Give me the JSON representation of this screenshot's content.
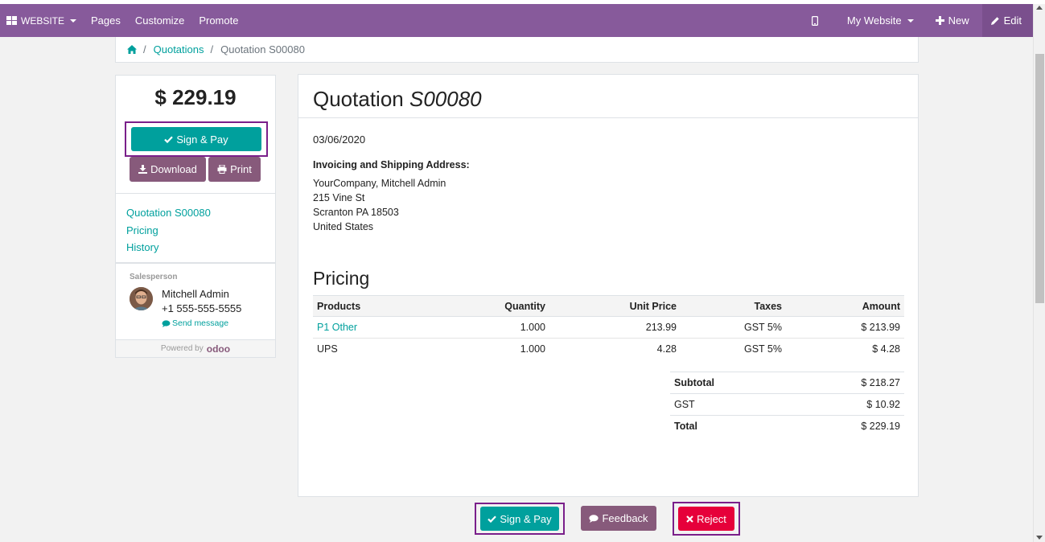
{
  "navbar": {
    "brand": "WEBSITE",
    "pages": "Pages",
    "customize": "Customize",
    "promote": "Promote",
    "site": "My Website",
    "new": "New",
    "edit": "Edit"
  },
  "breadcrumb": {
    "quotations": "Quotations",
    "current": "Quotation S00080"
  },
  "sidebar": {
    "amount": "$ 229.19",
    "sign_pay": "Sign & Pay",
    "download": "Download",
    "print": "Print",
    "nav": [
      "Quotation S00080",
      "Pricing",
      "History"
    ],
    "salesperson_label": "Salesperson",
    "salesperson_name": "Mitchell Admin",
    "salesperson_phone": "+1 555-555-5555",
    "send_message": "Send message",
    "powered_by": "Powered by",
    "powered_logo": "odoo"
  },
  "main": {
    "title_prefix": "Quotation",
    "title_number": "S00080",
    "date": "03/06/2020",
    "address_label": "Invoicing and Shipping Address:",
    "address": [
      "YourCompany, Mitchell Admin",
      "215 Vine St",
      "Scranton PA 18503",
      "United States"
    ],
    "pricing_heading": "Pricing",
    "columns": [
      "Products",
      "Quantity",
      "Unit Price",
      "Taxes",
      "Amount"
    ],
    "rows": [
      {
        "product": "P1 Other",
        "quantity": "1.000",
        "unit_price": "213.99",
        "taxes": "GST 5%",
        "amount": "$ 213.99"
      },
      {
        "product": "UPS",
        "quantity": "1.000",
        "unit_price": "4.28",
        "taxes": "GST 5%",
        "amount": "$ 4.28"
      }
    ],
    "totals": {
      "subtotal_label": "Subtotal",
      "subtotal": "$ 218.27",
      "gst_label": "GST",
      "gst": "$ 10.92",
      "total_label": "Total",
      "total": "$ 229.19"
    }
  },
  "actions": {
    "sign_pay": "Sign & Pay",
    "feedback": "Feedback",
    "reject": "Reject"
  },
  "colors": {
    "navbar": "#875a9b",
    "teal": "#00a09d",
    "purple_button": "#875a7b",
    "reject": "#e6003a",
    "highlight_border": "#7a1f8a"
  }
}
